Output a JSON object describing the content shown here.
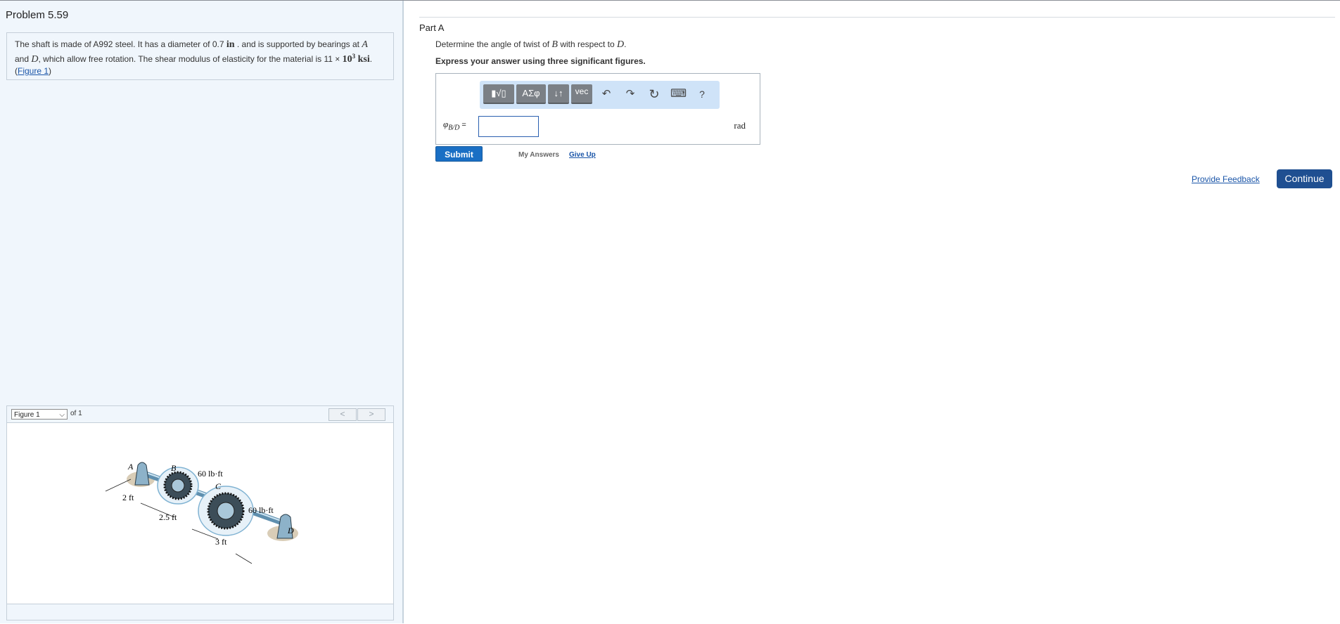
{
  "left": {
    "problem_title": "Problem 5.59",
    "problem": {
      "t1": "The shaft is made of A992 steel. It has a diameter of 0.7 ",
      "unit_in": "in",
      "t2": " . and is supported by bearings at ",
      "A": "A",
      "t3": "and ",
      "D": "D",
      "t4": ", which allow free rotation. The shear modulus of elasticity for the material is 11 × ",
      "ten": "10",
      "exp": "3",
      "ksi": " ksi",
      "t5": ".",
      "fig_link_open": "(",
      "fig_link": "Figure 1",
      "fig_link_close": ")"
    },
    "figure": {
      "select_value": "Figure 1",
      "of_text": "of 1",
      "prev": "<",
      "next": ">",
      "labels": {
        "A": "A",
        "B": "B",
        "C": "C",
        "D": "D",
        "torque1": "60 lb·ft",
        "torque2": "60 lb·ft",
        "dim1": "2 ft",
        "dim2": "2.5 ft",
        "dim3": "3 ft"
      }
    }
  },
  "right": {
    "part_title": "Part A",
    "question": {
      "t1": "Determine the angle of twist of ",
      "B": "B",
      "t2": " with respect to ",
      "D": "D",
      "t3": "."
    },
    "instruction": "Express your answer using three significant figures.",
    "toolbar": {
      "templates": "▮√▯",
      "greek": "ΑΣφ",
      "arrows": "↓↑",
      "vec": "vec",
      "undo": "↶",
      "redo": "↷",
      "reset": "↻",
      "keyboard": "⌨",
      "help": "?"
    },
    "answer": {
      "var_symbol": "φ",
      "var_sub": "B/D",
      "equals": " =",
      "value": "",
      "unit": "rad"
    },
    "submit": "Submit",
    "my_answers": "My Answers",
    "give_up": "Give Up",
    "feedback": "Provide Feedback",
    "continue": "Continue"
  }
}
